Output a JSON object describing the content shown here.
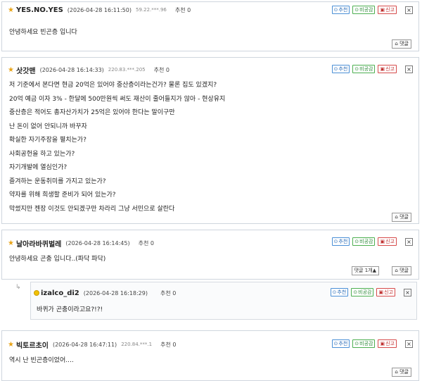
{
  "labels": {
    "recommend": "추천",
    "not_recommend": "비공감",
    "report": "신고",
    "reply": "댓글",
    "close": "×",
    "recommend_count": "추천 0"
  },
  "comments": [
    {
      "nick": "YES.NO.YES",
      "date": "(2026-04-28 16:11:50)",
      "ip": "59.22.***.96",
      "lines": [
        "안녕하세요 빈곤층 입니다"
      ]
    },
    {
      "nick": "삿갓맨",
      "date": "(2026-04-28 16:14:33)",
      "ip": "220.83.***.205",
      "lines": [
        "저 기준에서 본다면 현금 20억은 있어야 중산층이라는건가? 물론 집도 있겠지?",
        "20억 예금 이자 3% - 한달에 500만원씩 써도 재산이 줄어들지가 않아 - 현상유지",
        "중산층은 적어도 총자산가치가 25억은 있어야 한다는 말이구만",
        "난 돈이 없어 안되니까 바꾸자",
        "확실한 자기주장을 펼치는가?",
        "사회공헌을 하고 있는가?",
        "자기개발에 열심인가?",
        "즐겨하는 운동취미를 가지고 있는가?",
        "약자를 위해 희생할 준비가 되어 있는가?",
        "막썼지만   젠장 이것도 안되겠구만 차라리 그냥 서민으로 살란다"
      ]
    },
    {
      "nick": "날아라바퀴벌레",
      "date": "(2026-04-28 16:14:45)",
      "ip": "",
      "lines": [
        "안녕하세요 곤충 입니다..(파닥 파닥)"
      ],
      "reply_count": "댓글 1개▲"
    },
    {
      "nick": "izalco_di2",
      "date": "(2026-04-28 16:18:29)",
      "ip": "",
      "lines": [
        "바퀴가 곤충이라고요?!?!"
      ]
    },
    {
      "nick": "빅토르초이",
      "date": "(2026-04-28 16:47:11)",
      "ip": "220.84.***.1",
      "lines": [
        "역시 난 빈곤층이었어...."
      ]
    }
  ]
}
